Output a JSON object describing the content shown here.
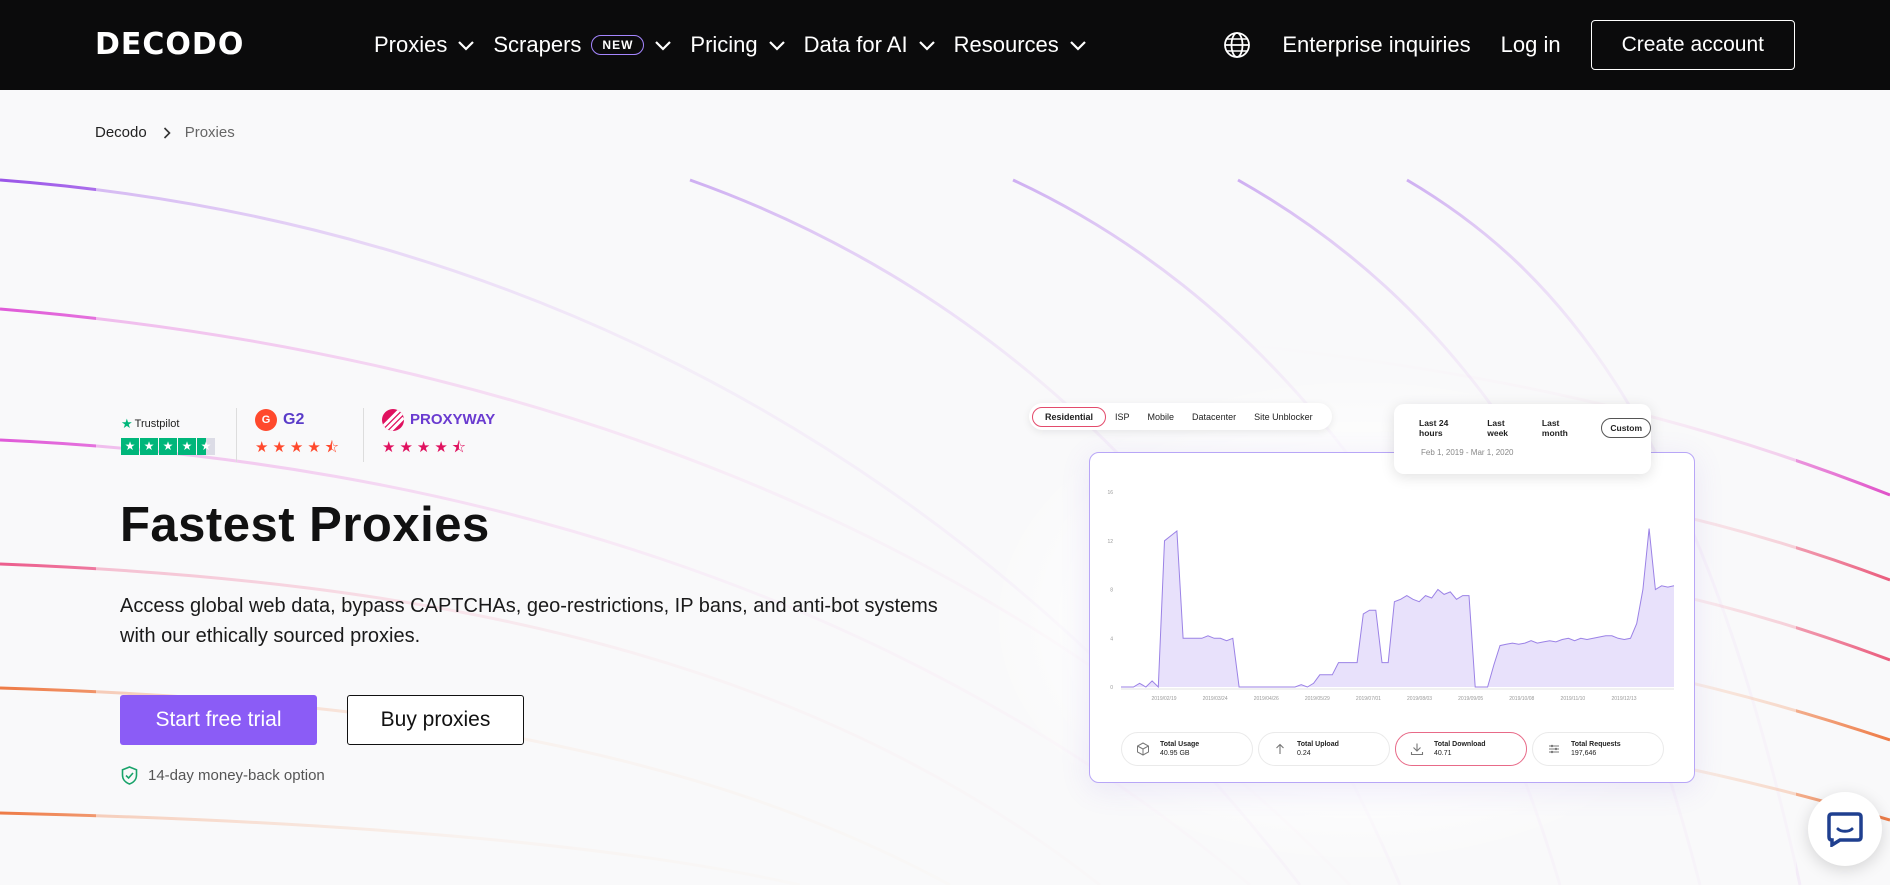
{
  "nav": {
    "logo": "DECODO",
    "menu": [
      {
        "label": "Proxies"
      },
      {
        "label": "Scrapers",
        "badge": "NEW"
      },
      {
        "label": "Pricing"
      },
      {
        "label": "Data for AI"
      },
      {
        "label": "Resources"
      }
    ],
    "enterprise": "Enterprise inquiries",
    "login": "Log in",
    "create_account": "Create account"
  },
  "breadcrumb": {
    "home": "Decodo",
    "current": "Proxies"
  },
  "ratings": {
    "trustpilot": {
      "name": "Trustpilot",
      "stars": 4.5
    },
    "g2": {
      "name": "G2",
      "stars": 4.5
    },
    "proxyway": {
      "name": "PROXYWAY",
      "stars": 4.5
    }
  },
  "hero": {
    "title": "Fastest Proxies",
    "description": "Access global web data, bypass CAPTCHAs, geo-restrictions, IP bans, and anti-bot systems with our ethically sourced proxies.",
    "primary_cta": "Start free trial",
    "secondary_cta": "Buy proxies",
    "guarantee": "14-day money-back option"
  },
  "dashboard": {
    "proxy_types": [
      "Residential",
      "ISP",
      "Mobile",
      "Datacenter",
      "Site Unblocker"
    ],
    "active_type": "Residential",
    "ranges": [
      "Last 24 hours",
      "Last week",
      "Last month",
      "Custom"
    ],
    "active_range": "Custom",
    "date_range": "Feb 1, 2019 - Mar 1, 2020",
    "stats": [
      {
        "label": "Total Usage",
        "value": "40.95 GB",
        "icon": "cube-icon"
      },
      {
        "label": "Total Upload",
        "value": "0.24",
        "icon": "upload-icon"
      },
      {
        "label": "Total Download",
        "value": "40.71",
        "icon": "download-icon",
        "active": true
      },
      {
        "label": "Total Requests",
        "value": "197,646",
        "icon": "requests-icon"
      }
    ]
  },
  "chart_data": {
    "type": "area",
    "y_ticks": [
      "0",
      "4",
      "8",
      "12",
      "16"
    ],
    "x_ticks": [
      "2019/02/19",
      "2019/03/24",
      "2019/04/26",
      "2019/05/29",
      "2019/07/01",
      "2019/08/03",
      "2019/09/05",
      "2019/10/08",
      "2019/11/10",
      "2019/12/13"
    ],
    "ylim": [
      0,
      16
    ],
    "values": [
      0,
      0,
      0,
      0.3,
      0,
      0.5,
      0,
      12,
      12.4,
      12.8,
      4,
      4,
      4,
      4,
      4.2,
      4,
      4,
      3.8,
      4,
      0,
      0,
      0,
      0,
      0,
      0,
      0,
      0,
      0,
      0,
      0.2,
      0,
      0.3,
      1,
      1,
      1,
      2,
      2,
      2,
      2,
      6,
      6.3,
      6.3,
      2,
      2,
      7,
      7.2,
      7.5,
      7.2,
      7,
      7.5,
      7.3,
      8,
      7.6,
      7.8,
      7.2,
      7.5,
      7.5,
      0,
      0,
      0,
      1.8,
      3.4,
      3.5,
      3.6,
      3.5,
      3.6,
      3.8,
      3.6,
      3.7,
      3.8,
      3.7,
      3.9,
      4,
      3.8,
      4,
      3.9,
      4,
      4.1,
      4.2,
      4.2,
      4,
      3.9,
      4,
      5.2,
      8,
      13,
      8,
      8.3,
      8.2,
      8.3
    ],
    "fill_color": "#e8e1fb",
    "line_color": "#9b82e6"
  },
  "colors": {
    "nav_bg": "#0b0b0c",
    "accent": "#8b5cf6"
  }
}
